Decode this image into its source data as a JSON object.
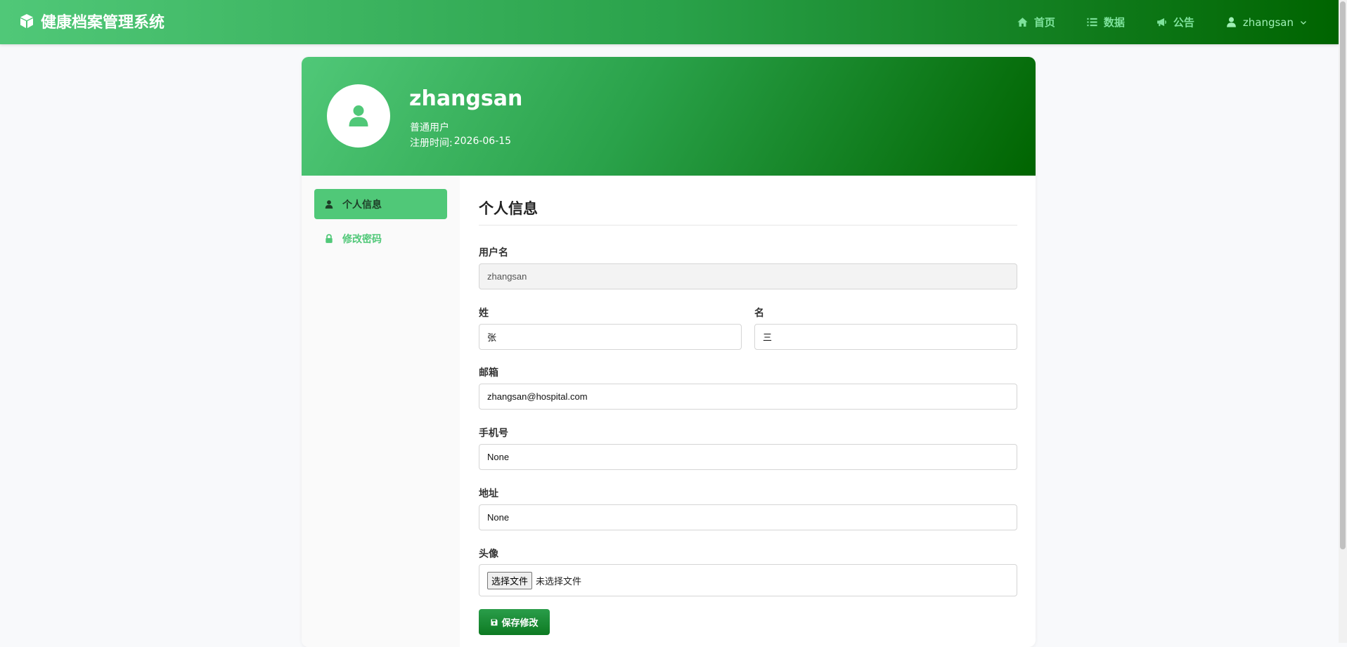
{
  "navbar": {
    "brand": "健康档案管理系统",
    "brand_icon": "cube-icon",
    "items": [
      {
        "label": "首页",
        "icon": "home-icon"
      },
      {
        "label": "数据",
        "icon": "list-icon"
      },
      {
        "label": "公告",
        "icon": "megaphone-icon"
      }
    ],
    "user": {
      "label": "zhangsan",
      "icon": "user-icon"
    }
  },
  "profile": {
    "username": "zhangsan",
    "role": "普通用户",
    "reg_label": "注册时间:",
    "reg_date": "2026-06-15"
  },
  "sidebar": {
    "items": [
      {
        "label": "个人信息",
        "icon": "user-icon",
        "active": true
      },
      {
        "label": "修改密码",
        "icon": "lock-icon",
        "active": false
      }
    ]
  },
  "form": {
    "title": "个人信息",
    "username": {
      "label": "用户名",
      "value": "zhangsan"
    },
    "last_name": {
      "label": "姓",
      "value": "张"
    },
    "first_name": {
      "label": "名",
      "value": "三"
    },
    "email": {
      "label": "邮箱",
      "value": "zhangsan@hospital.com"
    },
    "phone": {
      "label": "手机号",
      "value": "None"
    },
    "address": {
      "label": "地址",
      "value": "None"
    },
    "avatar": {
      "label": "头像",
      "button": "选择文件",
      "status": "未选择文件"
    },
    "save_label": "保存修改"
  },
  "colors": {
    "primary": "#50c878",
    "dark": "#006400",
    "background": "#f8f9fb"
  }
}
